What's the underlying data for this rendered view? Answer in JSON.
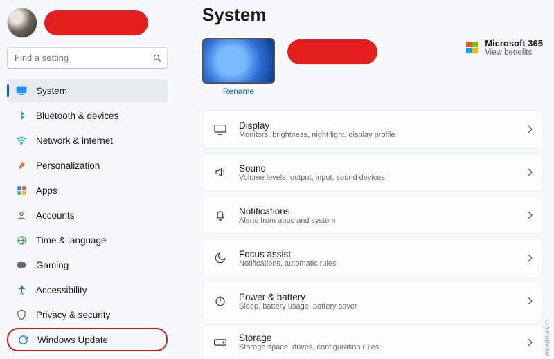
{
  "profile": {
    "avatar_alt": "user-avatar"
  },
  "search": {
    "placeholder": "Find a setting"
  },
  "sidebar": {
    "items": [
      {
        "label": "System"
      },
      {
        "label": "Bluetooth & devices"
      },
      {
        "label": "Network & internet"
      },
      {
        "label": "Personalization"
      },
      {
        "label": "Apps"
      },
      {
        "label": "Accounts"
      },
      {
        "label": "Time & language"
      },
      {
        "label": "Gaming"
      },
      {
        "label": "Accessibility"
      },
      {
        "label": "Privacy & security"
      },
      {
        "label": "Windows Update"
      }
    ]
  },
  "page": {
    "title": "System",
    "device": {
      "rename": "Rename"
    },
    "ms365": {
      "title": "Microsoft 365",
      "sub": "View benefits"
    },
    "settings": [
      {
        "title": "Display",
        "sub": "Monitors, brightness, night light, display profile"
      },
      {
        "title": "Sound",
        "sub": "Volume levels, output, input, sound devices"
      },
      {
        "title": "Notifications",
        "sub": "Alerts from apps and system"
      },
      {
        "title": "Focus assist",
        "sub": "Notifications, automatic rules"
      },
      {
        "title": "Power & battery",
        "sub": "Sleep, battery usage, battery saver"
      },
      {
        "title": "Storage",
        "sub": "Storage space, drives, configuration rules"
      }
    ]
  },
  "watermark": "wsxdn.com"
}
